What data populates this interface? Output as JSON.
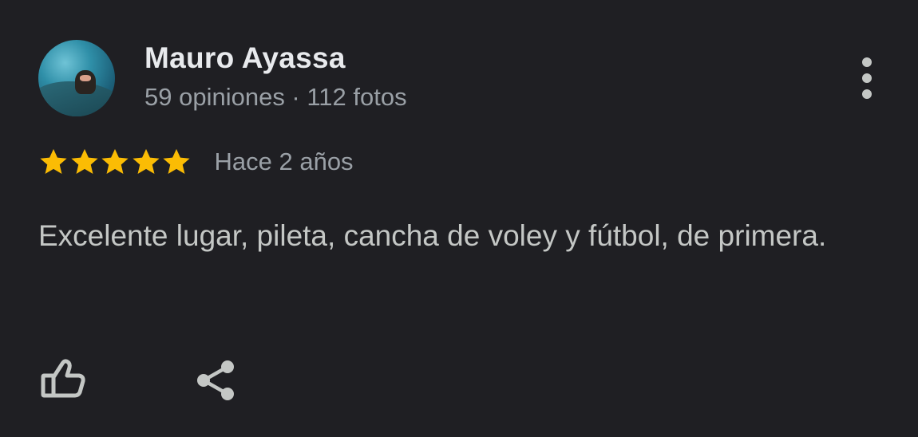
{
  "review": {
    "author": {
      "name": "Mauro Ayassa",
      "meta": "59 opiniones · 112 fotos"
    },
    "rating": 5,
    "rating_max": 5,
    "date": "Hace 2 años",
    "text": "Excelente lugar, pileta, cancha de voley y fútbol, de primera."
  },
  "icons": {
    "more": "more-vertical-icon",
    "star": "star-icon",
    "like": "thumbs-up-icon",
    "share": "share-icon"
  },
  "colors": {
    "background": "#1f1f23",
    "name": "#e8eaed",
    "secondary_text": "#9aa0a6",
    "body_text": "#c4c7c5",
    "star": "#fbbc04",
    "icon": "#c4c7c5"
  }
}
